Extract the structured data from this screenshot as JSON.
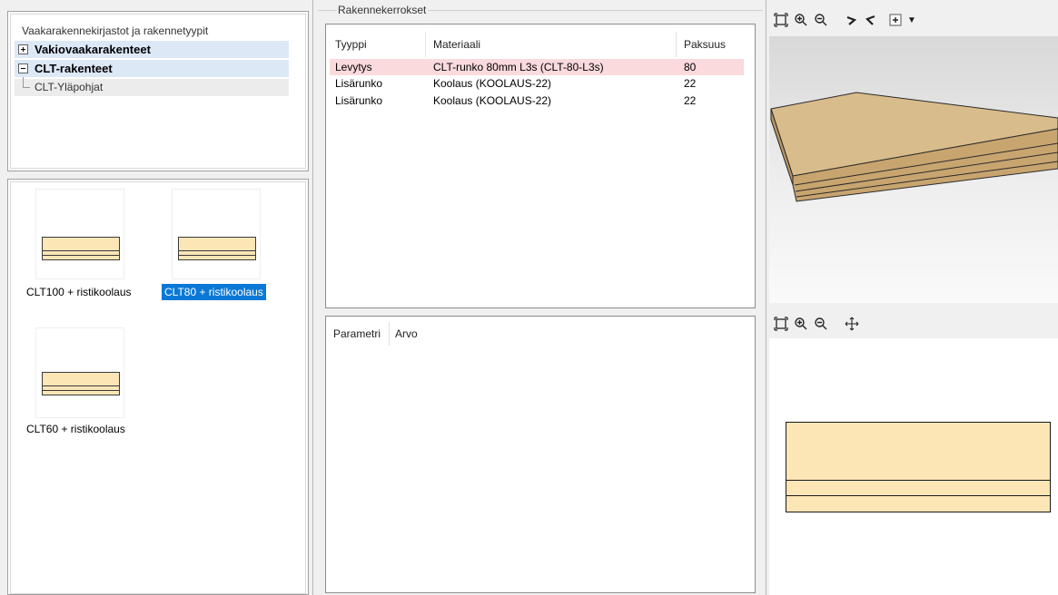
{
  "tree": {
    "header": "Vaakarakennekirjastot ja rakennetyypit",
    "nodes": [
      {
        "label": "Vakiovaakarakenteet",
        "expanded": false
      },
      {
        "label": "CLT-rakenteet",
        "expanded": true
      },
      {
        "label": "CLT-Yläpohjat"
      }
    ]
  },
  "thumbnails": [
    {
      "caption": "CLT100 + ristikoolaus",
      "selected": false
    },
    {
      "caption": "CLT80 + ristikoolaus",
      "selected": true
    },
    {
      "caption": "CLT60 + ristikoolaus",
      "selected": false
    }
  ],
  "layers": {
    "group_title": "Rakennekerrokset",
    "columns": [
      "Tyyppi",
      "Materiaali",
      "Paksuus"
    ],
    "rows": [
      {
        "type": "Levytys",
        "material": "CLT-runko 80mm L3s (CLT-80-L3s)",
        "thickness": "80",
        "selected": true
      },
      {
        "type": "Lisärunko",
        "material": "Koolaus (KOOLAUS-22)",
        "thickness": "22",
        "selected": false
      },
      {
        "type": "Lisärunko",
        "material": "Koolaus (KOOLAUS-22)",
        "thickness": "22",
        "selected": false
      }
    ]
  },
  "params": {
    "columns": [
      "Parametri",
      "Arvo"
    ]
  },
  "colors": {
    "selection": "#0a78d7",
    "selected_row": "#fadadd",
    "wood": "#fde6b6",
    "wood_3d_top": "#d6b98a"
  },
  "toolbar3d": [
    "zoom-extents-icon",
    "zoom-in-icon",
    "zoom-out-icon",
    "rotate-right-icon",
    "rotate-left-icon",
    "view-cube-icon",
    "dropdown-arrow-icon"
  ],
  "toolbar2d": [
    "zoom-extents-icon",
    "zoom-in-icon",
    "zoom-out-icon",
    "pan-icon"
  ]
}
